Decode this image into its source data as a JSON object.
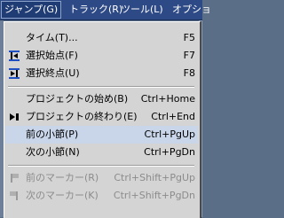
{
  "menubar": {
    "items": [
      {
        "label": "ジャンプ(G)"
      },
      {
        "label": "トラック(R)"
      },
      {
        "label": "ツール(L)"
      },
      {
        "label": "オプショ"
      }
    ]
  },
  "menu": {
    "items": [
      {
        "label": "タイム(T)...",
        "shortcut": "F5"
      },
      {
        "label": "選択始点(F)",
        "shortcut": "F7"
      },
      {
        "label": "選択終点(U)",
        "shortcut": "F8"
      },
      {
        "label": "プロジェクトの始め(B)",
        "shortcut": "Ctrl+Home"
      },
      {
        "label": "プロジェクトの終わり(E)",
        "shortcut": "Ctrl+End"
      },
      {
        "label": "前の小節(P)",
        "shortcut": "Ctrl+PgUp"
      },
      {
        "label": "次の小節(N)",
        "shortcut": "Ctrl+PgDn"
      },
      {
        "label": "前のマーカー(R)",
        "shortcut": "Ctrl+Shift+PgUp"
      },
      {
        "label": "次のマーカー(K)",
        "shortcut": "Ctrl+Shift+PgDn"
      }
    ]
  }
}
